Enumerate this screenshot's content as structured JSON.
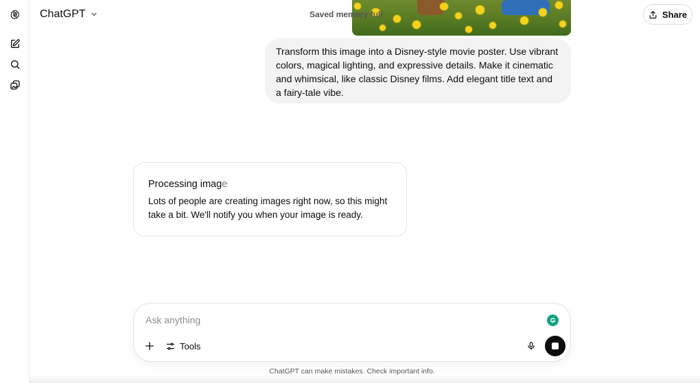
{
  "app": {
    "title": "ChatGPT",
    "saved_memory": "Saved memory full"
  },
  "sidebar": {
    "icons": [
      "openai-logo-icon",
      "new-chat-icon",
      "search-icon",
      "library-icon"
    ]
  },
  "header": {
    "share_label": "Share"
  },
  "user_message": {
    "text": "Transform this image into a Disney-style movie poster. Use vibrant colors, magical lighting, and expressive details. Make it cinematic and whimsical, like classic Disney films. Add elegant title text and a fairy-tale vibe."
  },
  "processing": {
    "title_main": "Processing imag",
    "title_shimmer": "e",
    "body": "Lots of people are creating images right now, so this might take a bit. We'll notify you when your image is ready."
  },
  "composer": {
    "placeholder": "Ask anything",
    "tools_label": "Tools"
  },
  "footer": {
    "disclaimer": "ChatGPT can make mistakes. Check important info."
  },
  "colors": {
    "accent": "#0d0d0d",
    "user_bubble": "#f3f3f3",
    "grammarly": "#15a37f"
  }
}
